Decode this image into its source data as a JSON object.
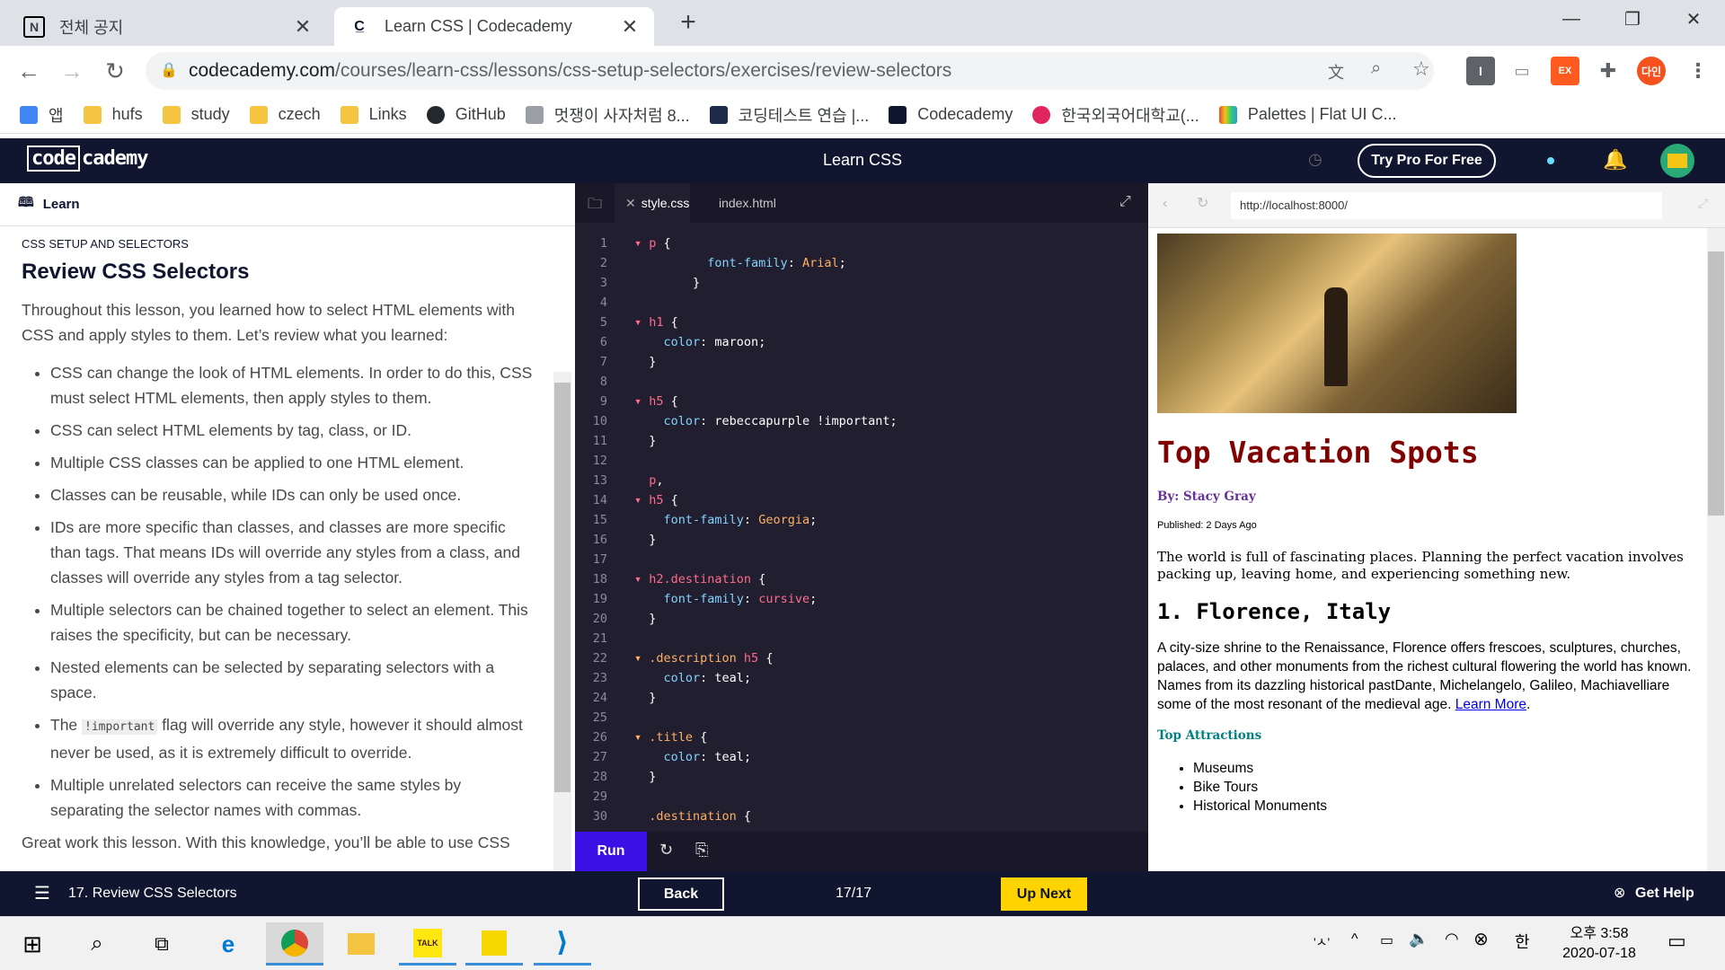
{
  "browser": {
    "tabs": [
      {
        "label": "전체 공지",
        "icon": "notion-icon"
      },
      {
        "label": "Learn CSS | Codecademy",
        "icon": "codecademy-icon"
      }
    ],
    "url_domain": "codecademy.com",
    "url_path": "/courses/learn-css/lessons/css-setup-selectors/exercises/review-selectors",
    "profile_label": "다인",
    "ext_label": "EX",
    "bookmarks": [
      {
        "label": "앱",
        "color": "#4285f4"
      },
      {
        "label": "hufs",
        "color": "#f5c542"
      },
      {
        "label": "study",
        "color": "#f5c542"
      },
      {
        "label": "czech",
        "color": "#f5c542"
      },
      {
        "label": "Links",
        "color": "#f5c542"
      },
      {
        "label": "GitHub",
        "color": "#24292e"
      },
      {
        "label": "멋쟁이 사자처럼 8...",
        "color": "#9aa0a6"
      },
      {
        "label": "코딩테스트 연습 |...",
        "color": "#1e2a4a"
      },
      {
        "label": "Codecademy",
        "color": "#10162f"
      },
      {
        "label": "한국외국어대학교(...",
        "color": "#e0245e"
      },
      {
        "label": "Palettes | Flat UI C...",
        "color": "#e67e22"
      }
    ]
  },
  "header": {
    "logo": "codecademy",
    "course_title": "Learn CSS",
    "try_pro": "Try Pro For Free"
  },
  "learn": {
    "heading": "Learn",
    "kicker": "CSS SETUP AND SELECTORS",
    "title": "Review CSS Selectors",
    "intro": "Throughout this lesson, you learned how to select HTML elements with CSS and apply styles to them. Let’s review what you learned:",
    "bullets": [
      "CSS can change the look of HTML elements. In order to do this, CSS must select HTML elements, then apply styles to them.",
      "CSS can select HTML elements by tag, class, or ID.",
      "Multiple CSS classes can be applied to one HTML element.",
      "Classes can be reusable, while IDs can only be used once.",
      "IDs are more specific than classes, and classes are more specific than tags. That means IDs will override any styles from a class, and classes will override any styles from a tag selector.",
      "Multiple selectors can be chained together to select an element. This raises the specificity, but can be necessary.",
      "Nested elements can be selected by separating selectors with a space."
    ],
    "important_pre": "The",
    "important_code": "!important",
    "important_post": "flag will override any style, however it should almost never be used, as it is extremely difficult to override.",
    "last_bullet": "Multiple unrelated selectors can receive the same styles by separating the selector names with commas.",
    "outro": "Great work this lesson. With this knowledge, you’ll be able to use CSS"
  },
  "editor": {
    "tabs": [
      "style.css",
      "index.html"
    ],
    "run_label": "Run"
  },
  "preview": {
    "url": "http://localhost:8000/",
    "title": "Top Vacation Spots",
    "byline": "By: Stacy Gray",
    "published": "Published: 2 Days Ago",
    "intro": "The world is full of fascinating places. Planning the perfect vacation involves packing up, leaving home, and experiencing something new.",
    "h2": "1. Florence, Italy",
    "desc": "A city-size shrine to the Renaissance, Florence offers frescoes, sculptures, churches, palaces, and other monuments from the richest cultural flowering the world has known. Names from its dazzling historical pastDante, Michelangelo, Galileo, Machiavelliare some of the most resonant of the medieval age.",
    "learn_more": "Learn More",
    "attr_heading": "Top Attractions",
    "attractions": [
      "Museums",
      "Bike Tours",
      "Historical Monuments"
    ]
  },
  "footer": {
    "lesson": "17. Review CSS Selectors",
    "back": "Back",
    "progress": "17/17",
    "up_next": "Up Next",
    "get_help": "Get Help"
  },
  "taskbar": {
    "ime": "'ㅅ'",
    "lang": "한",
    "time": "오후 3:58",
    "date": "2020-07-18"
  }
}
